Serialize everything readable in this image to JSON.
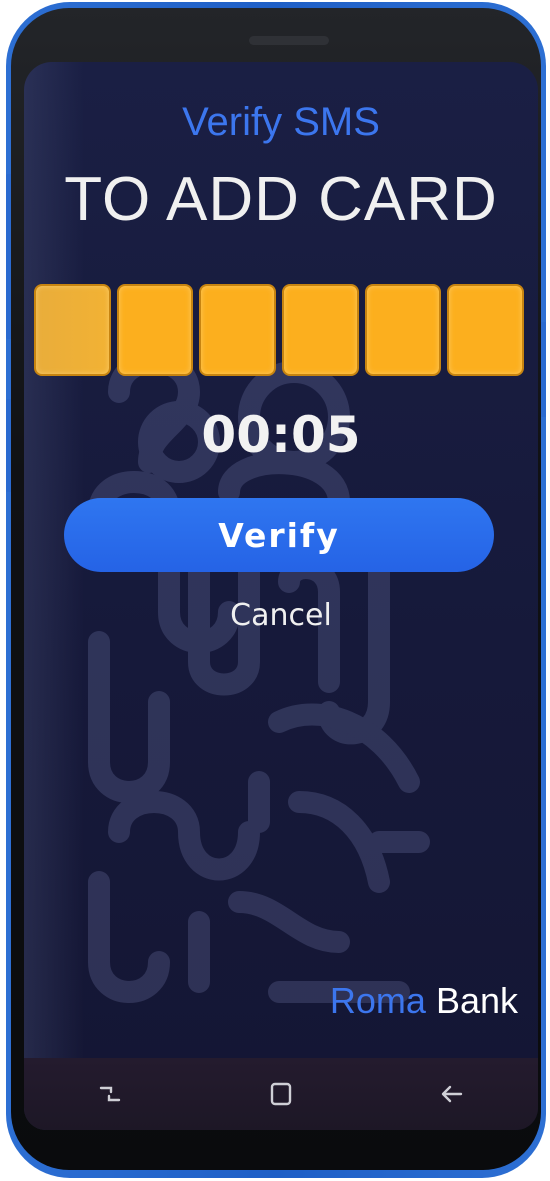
{
  "header": {
    "subtitle": "Verify SMS",
    "title": "TO ADD CARD"
  },
  "code": {
    "digits": [
      "",
      "",
      "",
      "",
      "",
      ""
    ]
  },
  "timer": "00:05",
  "actions": {
    "verify_label": "Verify",
    "cancel_label": "Cancel"
  },
  "brand": {
    "name_part1": "Roma",
    "name_part2": "Bank"
  },
  "navbar": {
    "icons": [
      "recent-apps-icon",
      "home-icon",
      "back-icon"
    ]
  },
  "colors": {
    "accent_blue": "#2f6cf0",
    "code_box": "#fcaf1e",
    "screen_bg": "#1a1f44"
  }
}
